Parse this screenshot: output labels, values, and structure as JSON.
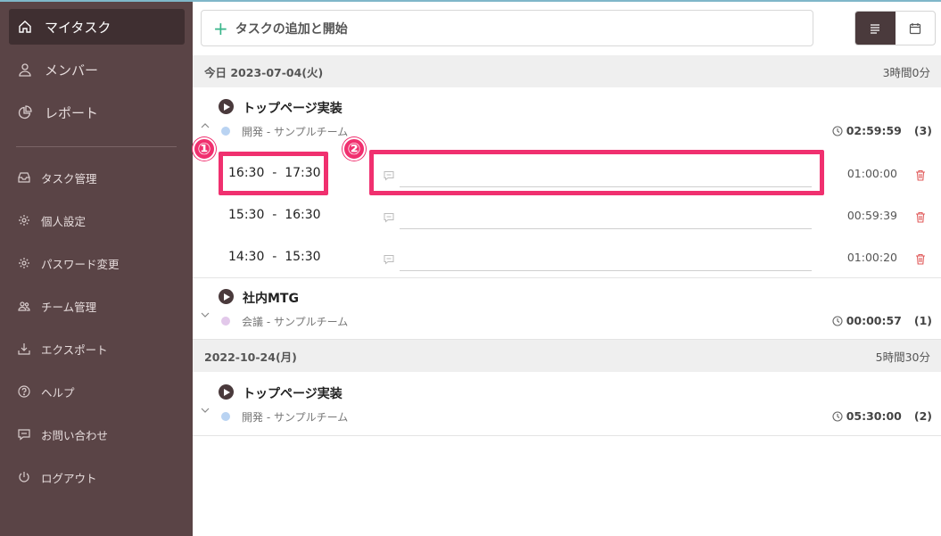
{
  "sidebar": {
    "items": [
      {
        "label": "マイタスク",
        "icon": "home-icon"
      },
      {
        "label": "メンバー",
        "icon": "user-icon"
      },
      {
        "label": "レポート",
        "icon": "pie-chart-icon"
      },
      {
        "label": "タスク管理",
        "icon": "inbox-icon"
      },
      {
        "label": "個人設定",
        "icon": "gear-icon"
      },
      {
        "label": "パスワード変更",
        "icon": "gear-icon"
      },
      {
        "label": "チーム管理",
        "icon": "team-icon"
      },
      {
        "label": "エクスポート",
        "icon": "download-icon"
      },
      {
        "label": "ヘルプ",
        "icon": "help-icon"
      },
      {
        "label": "お問い合わせ",
        "icon": "message-icon"
      },
      {
        "label": "ログアウト",
        "icon": "power-icon"
      }
    ]
  },
  "add_task": {
    "placeholder": "タスクの追加と開始"
  },
  "groups": [
    {
      "date": "今日 2023-07-04(火)",
      "total": "3時間0分",
      "tasks": [
        {
          "name": "トップページ実装",
          "team": "開発 - サンプルチーム",
          "team_color": "#b9d3f2",
          "duration": "02:59:59",
          "count": "(3)",
          "entries": [
            {
              "start": "16:30",
              "end": "17:30",
              "sep": "-",
              "duration": "01:00:00"
            },
            {
              "start": "15:30",
              "end": "16:30",
              "sep": "-",
              "duration": "00:59:39"
            },
            {
              "start": "14:30",
              "end": "15:30",
              "sep": "-",
              "duration": "01:00:20"
            }
          ]
        },
        {
          "name": "社内MTG",
          "team": "会議 - サンプルチーム",
          "team_color": "#e2c8ea",
          "duration": "00:00:57",
          "count": "(1)"
        }
      ]
    },
    {
      "date": "2022-10-24(月)",
      "total": "5時間30分",
      "tasks": [
        {
          "name": "トップページ実装",
          "team": "開発 - サンプルチーム",
          "team_color": "#b9d3f2",
          "duration": "05:30:00",
          "count": "(2)"
        }
      ]
    }
  ],
  "annotations": {
    "one": "①",
    "two": "②",
    "color": "#f0306f"
  }
}
